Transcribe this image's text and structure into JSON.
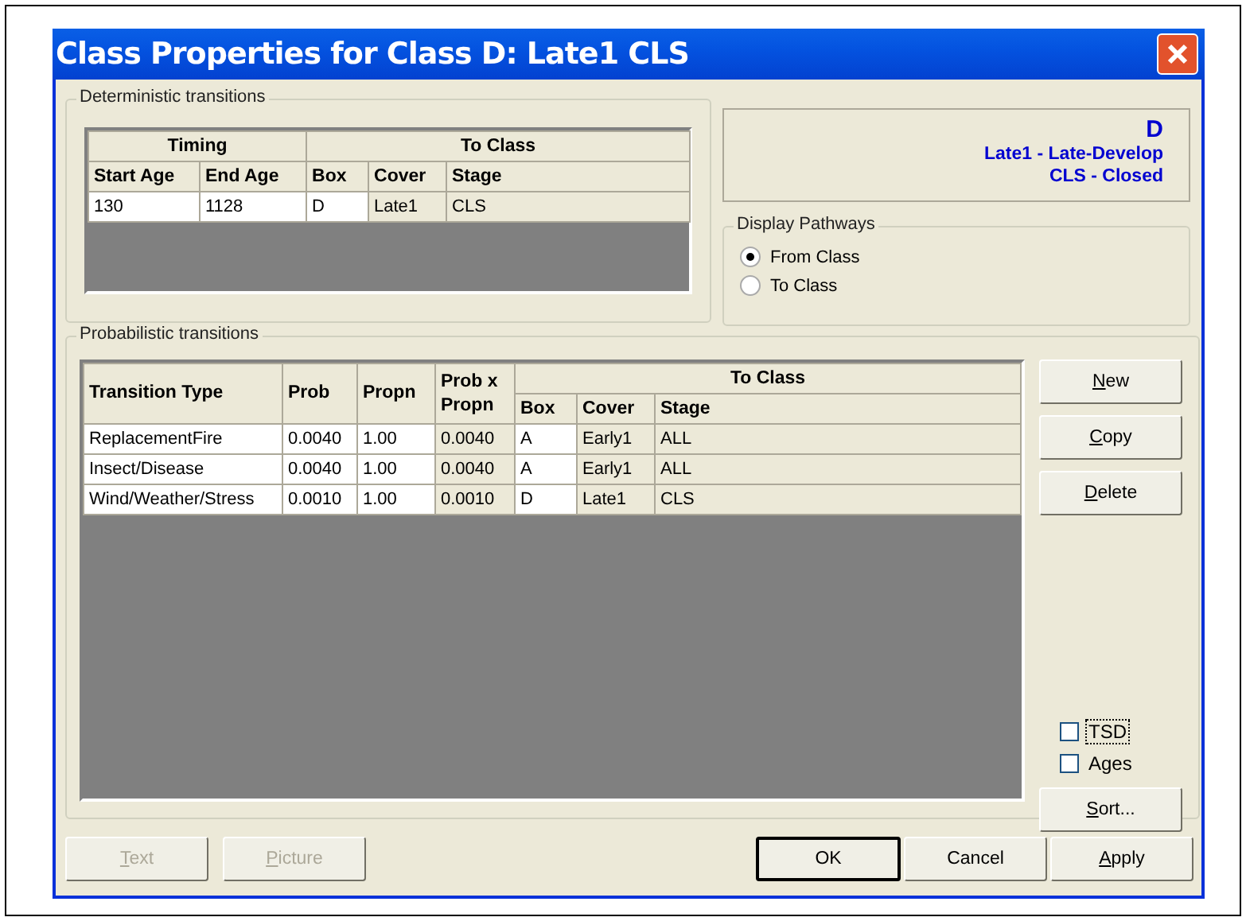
{
  "window": {
    "title": "Class Properties for Class D: Late1 CLS"
  },
  "deterministic": {
    "title": "Deterministic transitions",
    "groups": [
      {
        "label": "Timing",
        "columns": [
          {
            "label": "Start Age",
            "editable": true
          },
          {
            "label": "End Age",
            "editable": true
          }
        ]
      },
      {
        "label": "To Class",
        "columns": [
          {
            "label": "Box",
            "editable": true
          },
          {
            "label": "Cover",
            "editable": false
          },
          {
            "label": "Stage",
            "editable": false
          }
        ]
      }
    ],
    "rows": [
      [
        "130",
        "1128",
        "D",
        "Late1",
        "CLS"
      ]
    ]
  },
  "class_info": {
    "box": "D",
    "cover": "Late1 - Late-Develop",
    "stage": "CLS - Closed"
  },
  "pathways": {
    "title": "Display Pathways",
    "options": [
      {
        "label": "From Class",
        "selected": true
      },
      {
        "label": "To Class",
        "selected": false
      }
    ]
  },
  "probabilistic": {
    "title": "Probabilistic transitions",
    "columns": [
      {
        "label": "Transition Type",
        "editable": true
      },
      {
        "label": "Prob",
        "editable": true
      },
      {
        "label": "Propn",
        "editable": true
      },
      {
        "label": "Prob x Propn",
        "editable": false
      },
      {
        "label": "Box",
        "editable": true
      },
      {
        "label": "Cover",
        "editable": false
      },
      {
        "label": "Stage",
        "editable": false
      }
    ],
    "group": "To Class",
    "rows": [
      [
        "ReplacementFire",
        "0.0040",
        "1.00",
        "0.0040",
        "A",
        "Early1",
        "ALL"
      ],
      [
        "Insect/Disease",
        "0.0040",
        "1.00",
        "0.0040",
        "A",
        "Early1",
        "ALL"
      ],
      [
        "Wind/Weather/Stress",
        "0.0010",
        "1.00",
        "0.0010",
        "D",
        "Late1",
        "CLS"
      ]
    ]
  },
  "side_buttons": [
    {
      "key": "N",
      "after": "ew"
    },
    {
      "key": "C",
      "after": "opy"
    },
    {
      "key": "D",
      "after": "elete"
    }
  ],
  "checkboxes": [
    {
      "label": "TSD",
      "checked": false,
      "focused": true
    },
    {
      "label": "Ages",
      "checked": false,
      "focused": false
    }
  ],
  "sort_button": {
    "key": "S",
    "after": "ort..."
  },
  "bottom_left": [
    {
      "key": "T",
      "after": "ext",
      "disabled": true
    },
    {
      "key": "P",
      "after": "icture",
      "disabled": true
    }
  ],
  "bottom_right": [
    {
      "before": "OK",
      "default": true
    },
    {
      "before": "Cancel",
      "default": false
    },
    {
      "key": "A",
      "after": "pply",
      "default": false
    }
  ]
}
